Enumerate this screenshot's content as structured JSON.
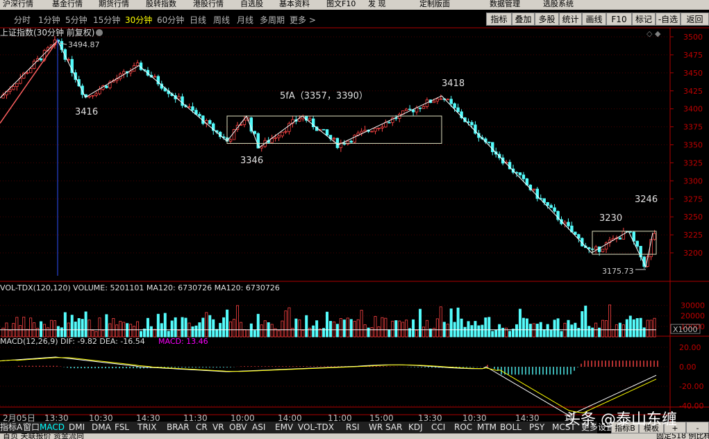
{
  "menubar": {
    "items": [
      "沪深行情",
      "基金行情",
      "期货行情",
      "股转指数",
      "港股行情",
      "自选股",
      "基本资料",
      "图文F10",
      "发  现",
      "定制版面",
      "数据管理",
      "选股系统"
    ]
  },
  "periods": [
    "分时",
    "1分钟",
    "5分钟",
    "15分钟",
    "30分钟",
    "60分钟",
    "日线",
    "周线",
    "月线",
    "多周期",
    "更多 >"
  ],
  "active_period": "30分钟",
  "toolbar": [
    "指标",
    "叠加",
    "多股",
    "统计",
    "画线",
    "F10",
    "标记",
    "-自选",
    "返回"
  ],
  "main_chart": {
    "title": "上证指数(30分钟 前复权)",
    "high_label": "3494.87",
    "low_label": "3175.73",
    "annotations": [
      "3416",
      "5fA（3357，3390）",
      "3418",
      "3346",
      "3230",
      "3246"
    ],
    "y_ticks": [
      "3500",
      "3475",
      "3450",
      "3425",
      "3400",
      "3375",
      "3350",
      "3325",
      "3300",
      "3275",
      "3250",
      "3225",
      "3200"
    ]
  },
  "volume": {
    "label": "VOL-TDX(120,120)",
    "volume_text": "VOLUME: 5201101",
    "ma1_text": "MA120: 6730726",
    "ma2_text": "MA120: 6730726",
    "y_ticks": [
      "30000",
      "20000",
      "10000"
    ],
    "unit": "X1000"
  },
  "macd": {
    "label": "MACD(12,26,9)",
    "dif_text": "DIF: -9.82",
    "dea_text": "DEA: -16.54",
    "macd_text": "MACD: 13.46",
    "y_ticks": [
      "20.00",
      "0.00",
      "-20.00",
      "-40.00"
    ]
  },
  "time_axis": [
    "2月05日",
    "13:30",
    "10:30",
    "14:30",
    "11:30",
    "10:00",
    "14:00",
    "11:00",
    "15:00",
    "13:30",
    "10:30",
    "14:30",
    "11"
  ],
  "bottom_tabs": [
    "指标A",
    "窗口",
    "MACD",
    "DMI",
    "DMA",
    "FSL",
    "TRIX",
    "BRAR",
    "CR",
    "VR",
    "OBV",
    "ASI",
    "EMV",
    "VOL-TDX",
    "RSI",
    "WR",
    "SAR",
    "KDJ",
    "CCI",
    "ROC",
    "MTM",
    "BOLL",
    "PSY",
    "MCST",
    "更多",
    "设置"
  ],
  "active_tab": "MACD",
  "right_buttons": [
    "指标B",
    "模板",
    "+",
    "-"
  ],
  "status": {
    "left": "首页  关联报价  资金流向",
    "right": "固定518 例比样..."
  },
  "watermark": "头条 @泰山东缠",
  "colors": {
    "up": "#ff4444",
    "down": "#54fcfc",
    "axis": "#b00000",
    "zigzag": "#ffffff",
    "dif": "#ffffff",
    "dea": "#ffff00",
    "macd_label": "#ff00ff",
    "background": "#000000"
  }
}
